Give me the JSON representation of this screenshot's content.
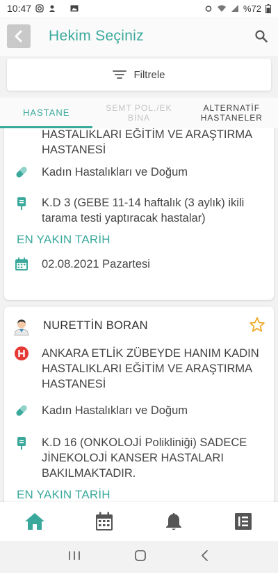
{
  "status_bar": {
    "time": "10:47",
    "battery": "%72"
  },
  "header": {
    "title": "Hekim Seçiniz"
  },
  "filter": {
    "label": "Filtrele"
  },
  "tabs": [
    {
      "label": "HASTANE"
    },
    {
      "label": "SEMT POL./EK BİNA"
    },
    {
      "label": "ALTERNATİF HASTANELER"
    }
  ],
  "cards": [
    {
      "hospital": "ANKARA ETLİK ZÜBEYDE HANIM KADIN HASTALIKLARI EĞİTİM VE ARAŞTIRMA HASTANESİ",
      "department": "Kadın Hastalıkları ve Doğum",
      "clinic": "K.D 3 (GEBE 11-14 haftalık (3 aylık) ikili tarama testi yaptıracak hastalar)",
      "nearest_label": "EN YAKIN TARİH",
      "date": "02.08.2021 Pazartesi"
    },
    {
      "doctor": "NURETTİN BORAN",
      "hospital": "ANKARA ETLİK ZÜBEYDE HANIM KADIN HASTALIKLARI EĞİTİM VE ARAŞTIRMA HASTANESİ",
      "department": "Kadın Hastalıkları ve Doğum",
      "clinic": "K.D 16 (ONKOLOJİ Polikliniği) SADECE JİNEKOLOJİ KANSER HASTALARI BAKILMAKTADIR.",
      "nearest_label": "EN YAKIN TARİH"
    }
  ],
  "icons": {
    "back": "back-arrow-icon",
    "search": "search-icon",
    "filter": "filter-icon",
    "hospital": "hospital-h-icon",
    "pill": "pill-icon",
    "clinic": "iv-bag-icon",
    "calendar": "calendar-icon",
    "doctor": "doctor-avatar-icon",
    "star": "star-outline-icon"
  },
  "colors": {
    "accent": "#3aa99c",
    "hospital_red": "#e53935",
    "star": "#f0a928",
    "nav_icons": "#555555"
  }
}
